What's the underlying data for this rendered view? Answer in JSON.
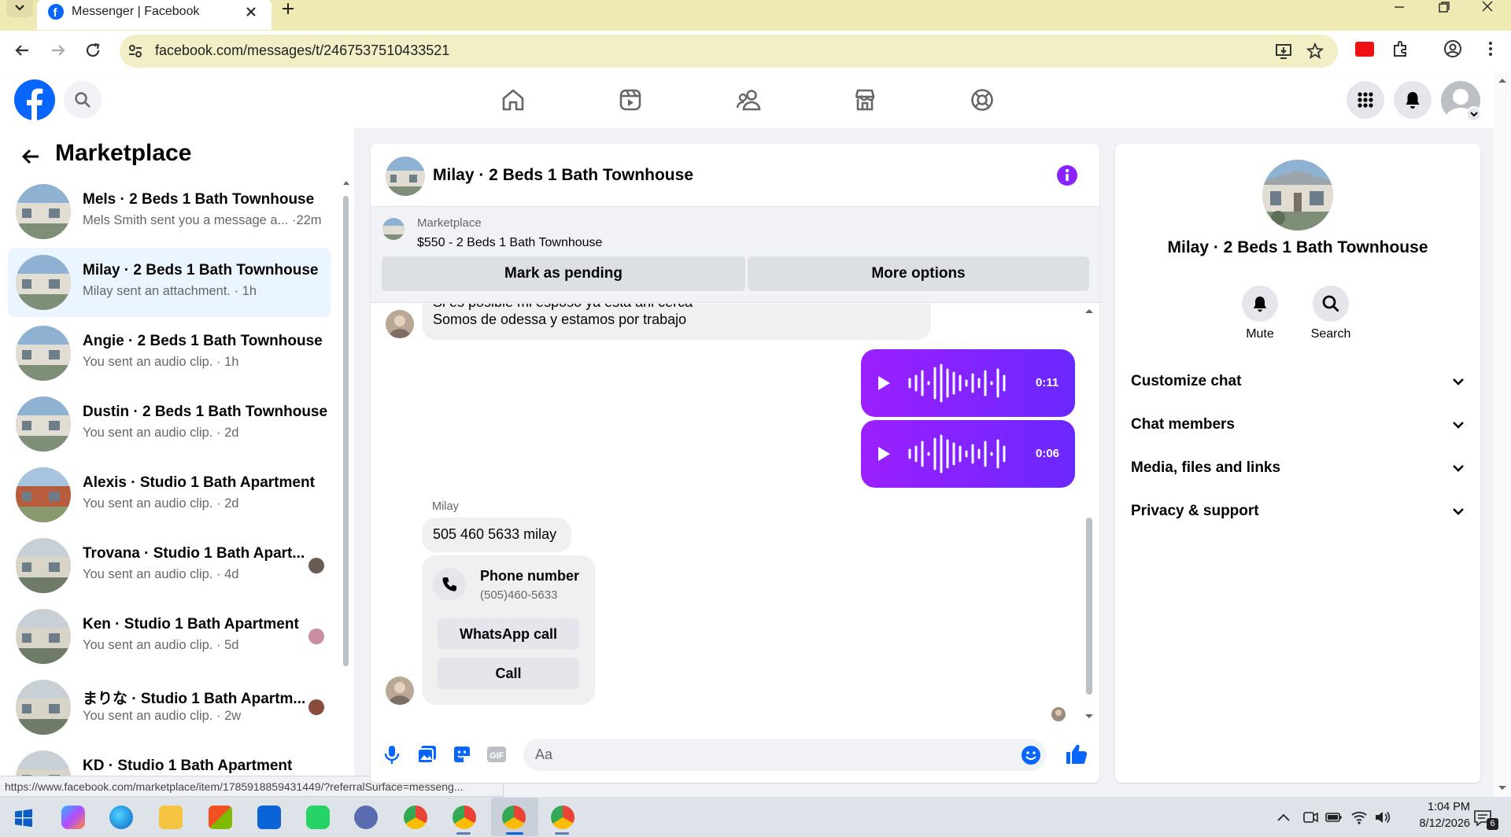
{
  "browser": {
    "tab_title": "Messenger | Facebook",
    "url": "facebook.com/messages/t/2467537510433521",
    "status_url": "https://www.facebook.com/marketplace/item/1785918859431449/?referralSurface=messeng..."
  },
  "sidebar": {
    "title": "Marketplace",
    "conversations": [
      {
        "name": "Mels · 2 Beds 1 Bath Townhouse",
        "preview": "Mels Smith sent you a message a... ·22m"
      },
      {
        "name": "Milay · 2 Beds 1 Bath Townhouse",
        "preview": "Milay sent an attachment. · 1h"
      },
      {
        "name": "Angie · 2 Beds 1 Bath Townhouse",
        "preview": "You sent an audio clip. · 1h"
      },
      {
        "name": "Dustin · 2 Beds 1 Bath Townhouse",
        "preview": "You sent an audio clip. · 2d"
      },
      {
        "name": "Alexis · Studio 1 Bath Apartment",
        "preview": "You sent an audio clip. · 2d"
      },
      {
        "name": "Trovana · Studio 1 Bath Apart...",
        "preview": "You sent an audio clip. · 4d"
      },
      {
        "name": "Ken · Studio 1 Bath Apartment",
        "preview": "You sent an audio clip. · 5d"
      },
      {
        "name": "まりな · Studio 1 Bath Apartm...",
        "preview": "You sent an audio clip. · 2w"
      },
      {
        "name": "KD · Studio 1 Bath Apartment",
        "preview": ""
      }
    ]
  },
  "chat": {
    "title": "Milay · 2 Beds 1 Bath Townhouse",
    "listing_source": "Marketplace",
    "listing_detail": "$550 - 2 Beds 1 Bath Townhouse",
    "mark_pending_label": "Mark as pending",
    "more_options_label": "More options",
    "message_cut": "Si es posible mi esposo ya esta ahi cerca",
    "message_1": "Somos de odessa y estamos por trabajo",
    "audio_1_duration": "0:11",
    "audio_2_duration": "0:06",
    "sender_label": "Milay",
    "message_2": "505 460 5633 milay",
    "phone_card_title": "Phone number",
    "phone_card_number": "(505)460-5633",
    "whatsapp_label": "WhatsApp call",
    "call_label": "Call",
    "composer_placeholder": "Aa"
  },
  "info_panel": {
    "title": "Milay · 2 Beds 1 Bath Townhouse",
    "mute_label": "Mute",
    "search_label": "Search",
    "sections": [
      "Customize chat",
      "Chat members",
      "Media, files and links",
      "Privacy & support"
    ]
  },
  "taskbar": {
    "time": "1:04 PM",
    "date": "8/12/2026",
    "notification_count": "6"
  },
  "colors": {
    "fb_blue": "#0866ff",
    "messenger_purple": "#8a24ff",
    "selected_bg": "#ebf5ff",
    "tab_strip": "#efe9b3"
  }
}
